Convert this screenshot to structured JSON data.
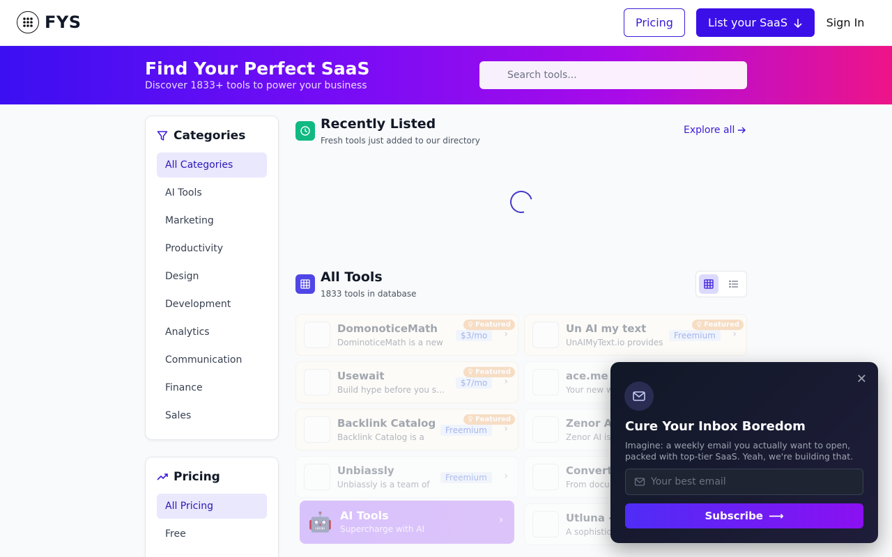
{
  "header": {
    "logo_text": "FYS",
    "pricing_label": "Pricing",
    "list_saas_label": "List your SaaS",
    "sign_in_label": "Sign In"
  },
  "hero": {
    "title": "Find Your Perfect SaaS",
    "subtitle": "Discover 1833+ tools to power your business",
    "search_placeholder": "Search tools..."
  },
  "categories": {
    "title": "Categories",
    "items": [
      {
        "label": "All Categories",
        "active": true
      },
      {
        "label": "AI Tools"
      },
      {
        "label": "Marketing"
      },
      {
        "label": "Productivity"
      },
      {
        "label": "Design"
      },
      {
        "label": "Development"
      },
      {
        "label": "Analytics"
      },
      {
        "label": "Communication"
      },
      {
        "label": "Finance"
      },
      {
        "label": "Sales"
      }
    ]
  },
  "pricing_filter": {
    "title": "Pricing",
    "items": [
      {
        "label": "All Pricing",
        "active": true
      },
      {
        "label": "Free"
      }
    ]
  },
  "recently_listed": {
    "title": "Recently Listed",
    "subtitle": "Fresh tools just added to our directory",
    "explore_label": "Explore all"
  },
  "all_tools": {
    "title": "All Tools",
    "subtitle": "1833 tools in database"
  },
  "tools": [
    {
      "name": "DomonoticeMath",
      "desc": "DominoticeMath is a new",
      "price": "$3/mo",
      "featured": "Featured"
    },
    {
      "name": "Un AI my text",
      "desc": "UnAIMyText.io provides",
      "price": "Freemium",
      "featured": "Featured"
    },
    {
      "name": "Usewait",
      "desc": "Build hype before you ship",
      "price": "$7/mo",
      "featured": "Featured"
    },
    {
      "name": "ace.me",
      "desc": "Your new w",
      "price": "",
      "featured": ""
    },
    {
      "name": "Backlink Catalog",
      "desc": "Backlink Catalog is a",
      "price": "Freemium",
      "featured": "Featured"
    },
    {
      "name": "Zenor AI",
      "desc": "Zenor AI is",
      "price": "",
      "featured": ""
    },
    {
      "name": "Unbiassly",
      "desc": "Unbiassly is a team of",
      "price": "Freemium",
      "featured": ""
    },
    {
      "name": "Convert",
      "desc": "From docu",
      "price": "",
      "featured": ""
    },
    {
      "name": "Utluna -",
      "desc": "A sophistic",
      "price": "",
      "featured": ""
    }
  ],
  "promo": {
    "emoji": "🤖",
    "title": "AI Tools",
    "subtitle": "Supercharge with AI"
  },
  "newsletter": {
    "title": "Cure Your Inbox Boredom",
    "text": "Imagine: a weekly email you actually want to open, packed with top-tier SaaS. Yeah, we're building that.",
    "email_placeholder": "Your best email",
    "subscribe_label": "Subscribe"
  },
  "colors": {
    "brand": "#3b10e8",
    "accent_green": "#10b981"
  }
}
